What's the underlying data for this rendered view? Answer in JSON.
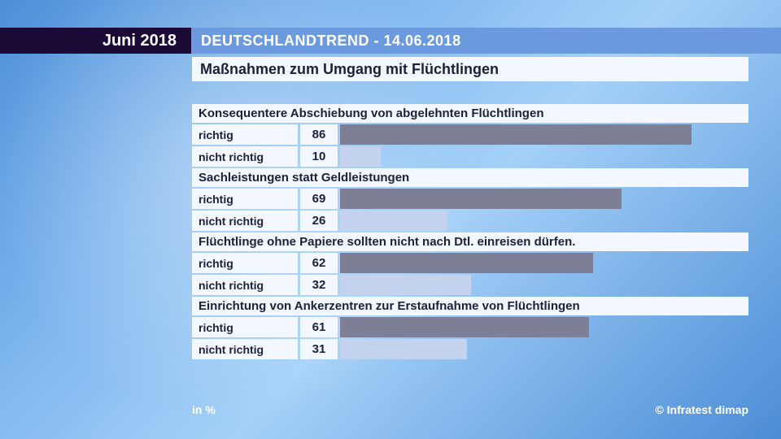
{
  "header": {
    "date_box": "Juni 2018",
    "title": "DEUTSCHLANDTREND - 14.06.2018",
    "subtitle": "Maßnahmen zum Umgang mit Flüchtlingen"
  },
  "labels": {
    "yes": "richtig",
    "no": "nicht richtig"
  },
  "footer": {
    "unit": "in %",
    "source": "© Infratest dimap"
  },
  "chart_data": {
    "type": "bar",
    "title": "Maßnahmen zum Umgang mit Flüchtlingen",
    "unit": "%",
    "max": 100,
    "groups": [
      {
        "question": "Konsequentere Abschiebung von abgelehnten Flüchtlingen",
        "yes": 86,
        "no": 10
      },
      {
        "question": "Sachleistungen statt Geldleistungen",
        "yes": 69,
        "no": 26
      },
      {
        "question": "Flüchtlinge ohne Papiere sollten nicht nach Dtl. einreisen dürfen.",
        "yes": 62,
        "no": 32
      },
      {
        "question": "Einrichtung von Ankerzentren zur Erstaufnahme von Flüchtlingen",
        "yes": 61,
        "no": 31
      }
    ]
  }
}
